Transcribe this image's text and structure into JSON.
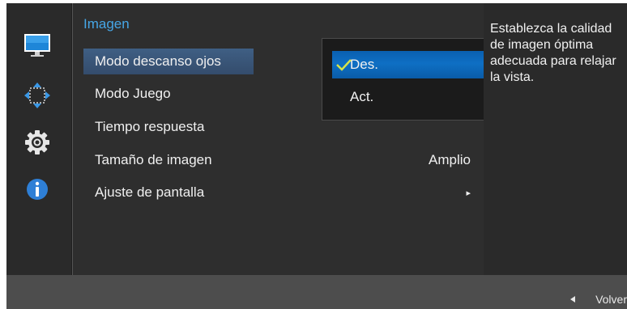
{
  "menu": {
    "title": "Imagen",
    "items": [
      {
        "label": "Modo descanso ojos",
        "value": "",
        "selected": true
      },
      {
        "label": "Modo Juego",
        "value": ""
      },
      {
        "label": "Tiempo respuesta",
        "value": ""
      },
      {
        "label": "Tamaño de imagen",
        "value": "Amplio"
      },
      {
        "label": "Ajuste de pantalla",
        "value": "▸"
      }
    ]
  },
  "submenu": {
    "options": [
      {
        "label": "Des.",
        "checked": true
      },
      {
        "label": "Act.",
        "checked": false
      }
    ]
  },
  "help": {
    "text": "Establezca la calidad de imagen óptima adecuada para relajar la vista."
  },
  "footer": {
    "back_label": "Volver"
  },
  "sidebar": {
    "icons": [
      "monitor-icon",
      "move-arrows-icon",
      "gear-icon",
      "info-icon"
    ]
  },
  "colors": {
    "accent_title": "#46a6e6",
    "selected_option": "#0e6fc4",
    "check": "#d6e34a",
    "info_icon": "#2e7fd6"
  }
}
